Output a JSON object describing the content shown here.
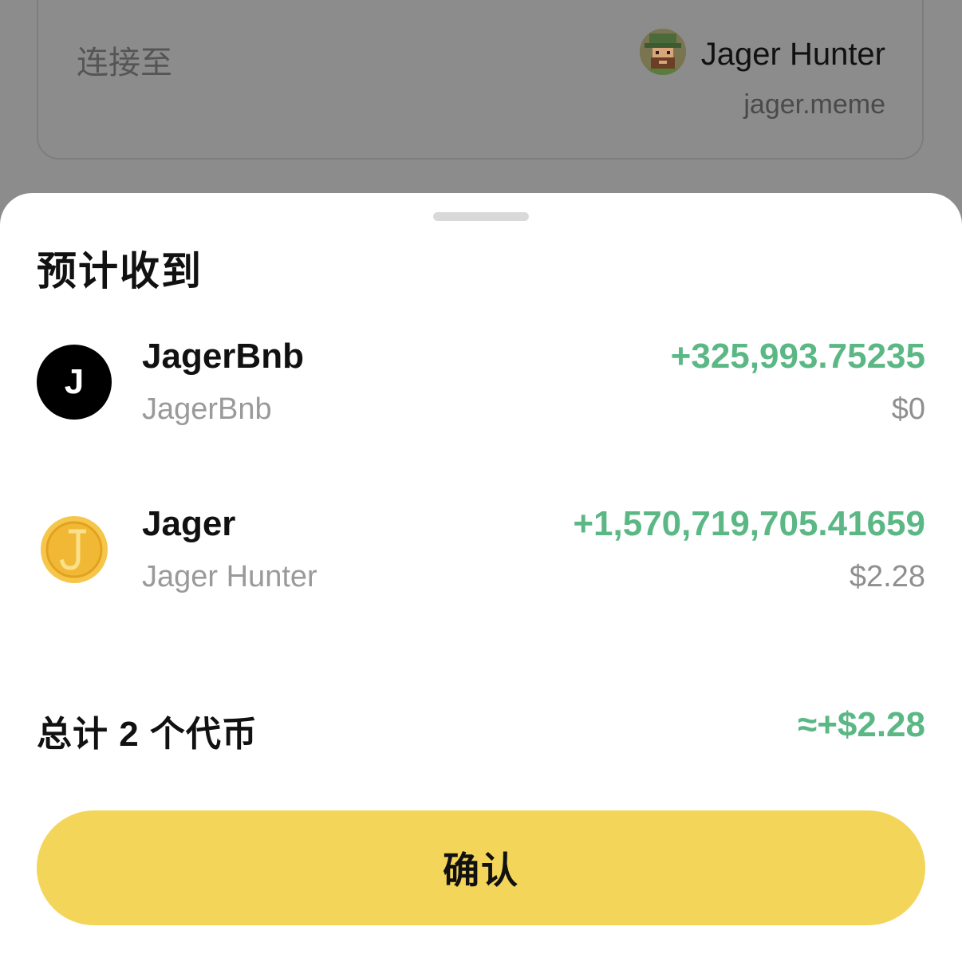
{
  "connect": {
    "label": "连接至",
    "dapp_name": "Jager Hunter",
    "dapp_domain": "jager.meme",
    "avatar_icon": "pixel-hunter-avatar"
  },
  "sheet": {
    "title": "预计收到",
    "tokens": [
      {
        "symbol": "JagerBnb",
        "name": "JagerBnb",
        "amount": "+325,993.75235",
        "value": "$0",
        "icon_letter": "J",
        "icon": "letter-j-black-circle-icon"
      },
      {
        "symbol": "Jager",
        "name": "Jager Hunter",
        "amount": "+1,570,719,705.41659",
        "value": "$2.28",
        "icon": "gold-coin-j-icon"
      }
    ],
    "total_label": "总计 2 个代币",
    "total_value": "≈+$2.28",
    "confirm_label": "确认"
  },
  "colors": {
    "accent_yellow": "#f3d55a",
    "positive_green": "#5bb885",
    "secondary_gray": "#9a9a9a"
  }
}
